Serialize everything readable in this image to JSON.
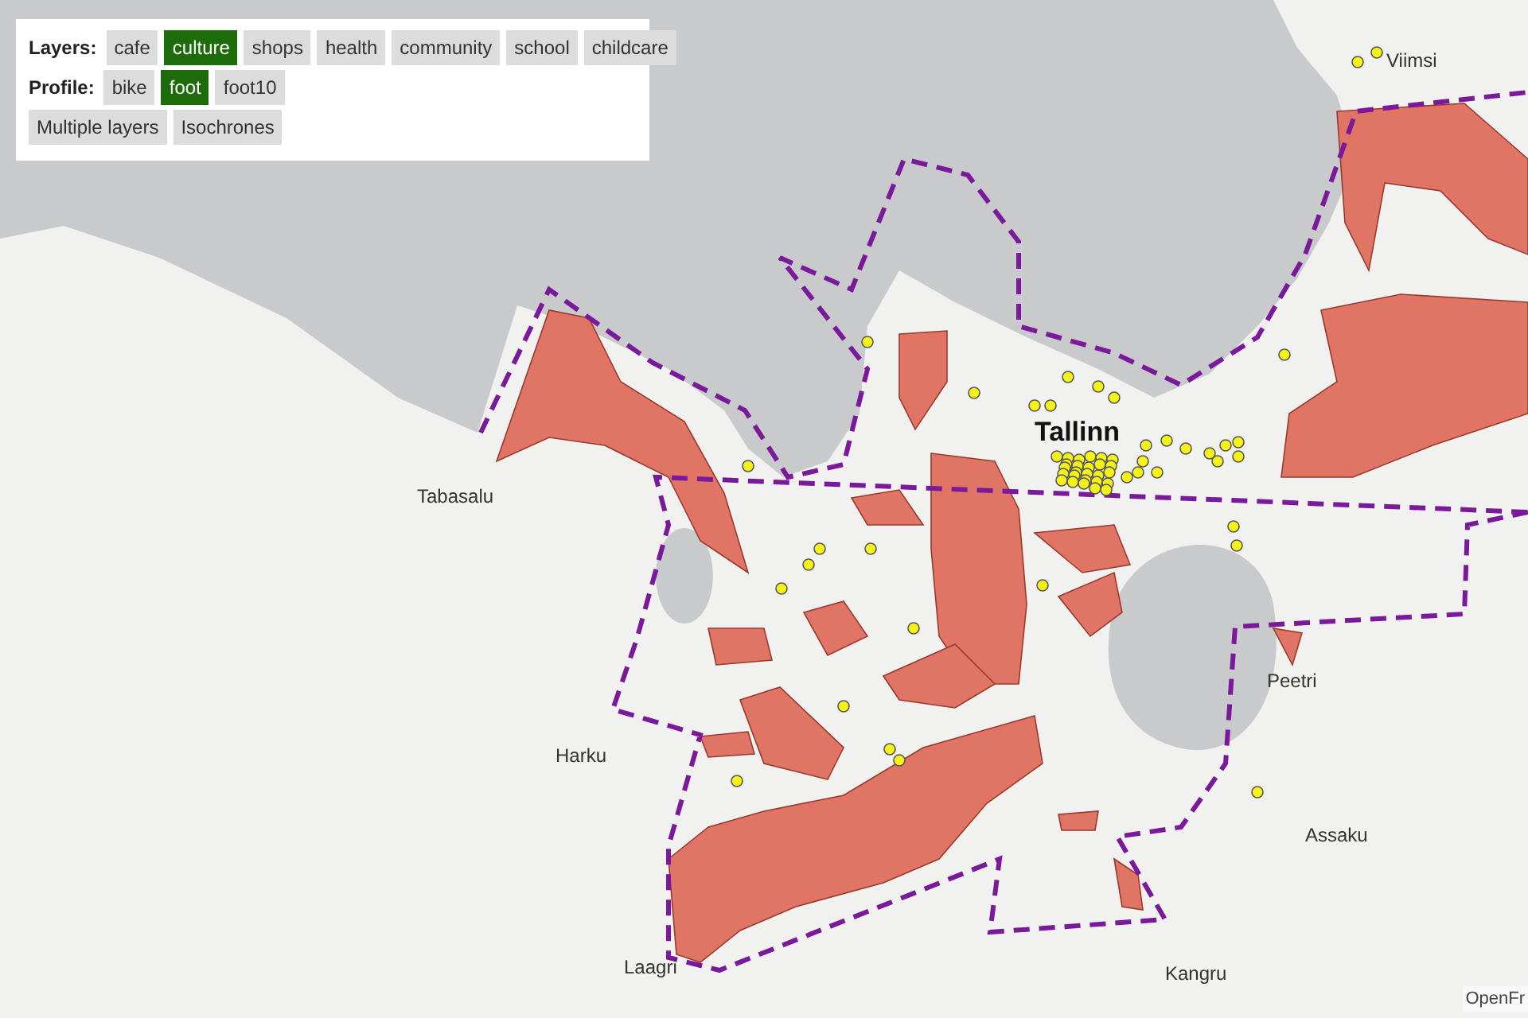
{
  "controls": {
    "layers_label": "Layers:",
    "layers": [
      {
        "label": "cafe",
        "selected": false
      },
      {
        "label": "culture",
        "selected": true
      },
      {
        "label": "shops",
        "selected": false
      },
      {
        "label": "health",
        "selected": false
      },
      {
        "label": "community",
        "selected": false
      },
      {
        "label": "school",
        "selected": false
      },
      {
        "label": "childcare",
        "selected": false
      }
    ],
    "profile_label": "Profile:",
    "profiles": [
      {
        "label": "bike",
        "selected": false
      },
      {
        "label": "foot",
        "selected": true
      },
      {
        "label": "foot10",
        "selected": false
      }
    ],
    "actions": [
      "Multiple layers",
      "Isochrones"
    ]
  },
  "map": {
    "place_labels": [
      {
        "name": "Viimsi",
        "kind": "town"
      },
      {
        "name": "Tallinn",
        "kind": "city"
      },
      {
        "name": "Tabasalu",
        "kind": "town"
      },
      {
        "name": "Harku",
        "kind": "town"
      },
      {
        "name": "Peetri",
        "kind": "town"
      },
      {
        "name": "Assaku",
        "kind": "town"
      },
      {
        "name": "Kangru",
        "kind": "town"
      },
      {
        "name": "Laagri",
        "kind": "town"
      }
    ],
    "attribution": "OpenFr"
  }
}
